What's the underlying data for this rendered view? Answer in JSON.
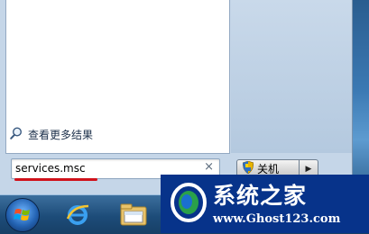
{
  "start_menu": {
    "see_more_label": "查看更多结果",
    "search": {
      "value": "services.msc",
      "clear_symbol": "×"
    },
    "shutdown": {
      "label": "关机",
      "arrow": "▶"
    }
  },
  "taskbar": {
    "items": [
      {
        "icon": "windows-start-orb-icon"
      },
      {
        "icon": "internet-explorer-icon"
      },
      {
        "icon": "file-explorer-icon"
      }
    ]
  },
  "watermark": {
    "title": "系统之家",
    "url": "www.Ghost123.com"
  },
  "colors": {
    "accent_red": "#d0121b",
    "menu_bg": "#c5d6e8",
    "taskbar": "#1d4c79",
    "watermark_bg": "#07338a"
  }
}
